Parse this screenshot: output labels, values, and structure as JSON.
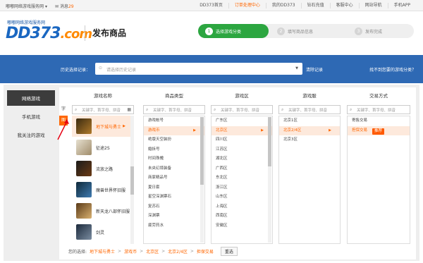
{
  "topbar": {
    "greeting": "嘟嘟网络游戏服务网",
    "greeting_arrow": "▾",
    "message_label": "消息",
    "message_count": "29",
    "nav": [
      "DD373首页",
      "订单处理中心",
      "我的DD373",
      "钻石充值",
      "客服中心",
      "网站导航",
      "手机APP"
    ]
  },
  "header": {
    "logo_sub": "嘟嘟网络游戏服务网",
    "logo_main": "DD373",
    "logo_com": ".com",
    "page_title": "发布商品",
    "steps": [
      {
        "num": "1",
        "label": "选择游戏分类",
        "active": true
      },
      {
        "num": "2",
        "label": "填写商品信息",
        "active": false
      },
      {
        "num": "3",
        "label": "发布完成",
        "active": false
      }
    ]
  },
  "history": {
    "label": "历史选择记录：",
    "placeholder": "请选择历史记录",
    "clear": "清除记录",
    "not_found": "找不到您要的游戏分类？"
  },
  "leftnav": {
    "items": [
      "网络游戏",
      "手机游戏",
      "我关注的游戏"
    ],
    "active_index": 0
  },
  "letters": {
    "zi": "字",
    "tu": "图"
  },
  "columns": {
    "game": {
      "header": "游戏名称",
      "placeholder": "关键字、首字母、拼音",
      "items": [
        "地下城与勇士",
        "征途2S",
        "流放之路",
        "魔兽世界怀旧服",
        "新天龙八部怀旧服",
        "剑灵"
      ],
      "selected": 0
    },
    "type": {
      "header": "商品类型",
      "placeholder": "关键字、首字母、拼音",
      "items": [
        "游戏帐号",
        "游戏币",
        "绝版天空装扮",
        "婚拆号",
        "时间珠魄",
        "未央幻境装备",
        "商家精品号",
        "夏日套",
        "星空深渊票石",
        "复苏石",
        "深渊票",
        "疲劳药水"
      ],
      "selected": 1
    },
    "zone": {
      "header": "游戏区",
      "placeholder": "关键字、首字母、拼音",
      "items": [
        "广东区",
        "北京区",
        "四川区",
        "江苏区",
        "湖北区",
        "广西区",
        "东北区",
        "浙江区",
        "山东区",
        "上海区",
        "西南区",
        "安徽区"
      ],
      "selected": 1
    },
    "server": {
      "header": "游戏服",
      "placeholder": "关键字、首字母、拼音",
      "items": [
        "北京1区",
        "北京2/4区",
        "北京3区"
      ],
      "selected": 1
    },
    "trade": {
      "header": "交易方式",
      "placeholder": "关键字、首字母、拼音",
      "items": [
        "寄售交易",
        "担保交易"
      ],
      "selected": 1,
      "badge": "推荐"
    }
  },
  "selection": {
    "label": "您的选择:",
    "values": [
      "地下城与勇士",
      "游戏币",
      "北京区",
      "北京2/4区",
      "担保交易"
    ],
    "sep": ">",
    "reset": "重选"
  },
  "icons": {
    "search": "search-icon",
    "grid": "grid-icon",
    "dropdown": "chevron-down-icon",
    "arrow": "chevron-right-icon"
  },
  "colors": {
    "accent": "#ff6600",
    "band": "#2e69b4",
    "step_active": "#2ca640"
  }
}
